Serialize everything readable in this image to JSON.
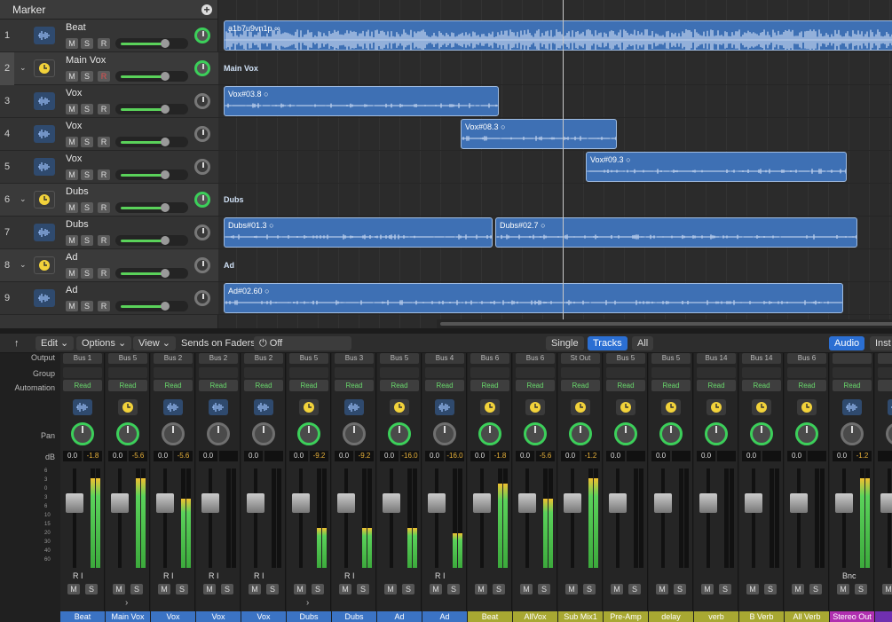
{
  "marker_label": "Marker",
  "tracks": [
    {
      "num": "1",
      "name": "Beat",
      "type": "audio",
      "r_red": false,
      "vol": 0.7,
      "pan_active": true
    },
    {
      "num": "2",
      "name": "Main Vox",
      "type": "folder",
      "r_red": true,
      "vol": 0.7,
      "pan_active": true
    },
    {
      "num": "3",
      "name": "Vox",
      "type": "audio",
      "r_red": false,
      "vol": 0.7,
      "pan_active": false
    },
    {
      "num": "4",
      "name": "Vox",
      "type": "audio",
      "r_red": false,
      "vol": 0.7,
      "pan_active": false
    },
    {
      "num": "5",
      "name": "Vox",
      "type": "audio",
      "r_red": false,
      "vol": 0.7,
      "pan_active": false
    },
    {
      "num": "6",
      "name": "Dubs",
      "type": "folder",
      "r_red": false,
      "vol": 0.7,
      "pan_active": true
    },
    {
      "num": "7",
      "name": "Dubs",
      "type": "audio",
      "r_red": false,
      "vol": 0.7,
      "pan_active": false
    },
    {
      "num": "8",
      "name": "Ad",
      "type": "folder",
      "r_red": false,
      "vol": 0.7,
      "pan_active": false
    },
    {
      "num": "9",
      "name": "Ad",
      "type": "audio",
      "r_red": false,
      "vol": 0.7,
      "pan_active": false
    }
  ],
  "regions": [
    {
      "label": "a1b7u9vn1p",
      "loop": "∞",
      "row": 0
    },
    {
      "label": "Main Vox",
      "row": 1,
      "stack": true
    },
    {
      "label": "Vox#03.8",
      "loop": "○",
      "row": 2
    },
    {
      "label": "Vox#08.3",
      "loop": "○",
      "row": 3
    },
    {
      "label": "Vox#09.3",
      "loop": "○",
      "row": 4
    },
    {
      "label": "Dubs",
      "row": 5,
      "stack": true
    },
    {
      "label": "Dubs#01.3",
      "loop": "○",
      "row": 6
    },
    {
      "label": "Dubs#02.7",
      "loop": "○",
      "row": 6
    },
    {
      "label": "Ad",
      "row": 7,
      "stack": true
    },
    {
      "label": "Ad#02.60",
      "loop": "○",
      "row": 8
    }
  ],
  "mixbar": {
    "edit": "Edit",
    "options": "Options",
    "view": "View",
    "sends_label": "Sends on Faders:",
    "sends_value": "Off",
    "single": "Single",
    "tracks": "Tracks",
    "all": "All",
    "audio": "Audio",
    "inst": "Inst"
  },
  "row_labels": {
    "output": "Output",
    "group": "Group",
    "automation": "Automation",
    "pan": "Pan",
    "db": "dB"
  },
  "strips": [
    {
      "output": "Bus 1",
      "auto": "Read",
      "icon": "wave",
      "db0": "0.0",
      "db1": "-1.8",
      "name": "Beat",
      "color": "#3b73c4",
      "pan_active": true,
      "ri": "R I"
    },
    {
      "output": "Bus 5",
      "auto": "Read",
      "icon": "folder",
      "db0": "0.0",
      "db1": "-5.6",
      "name": "Main Vox",
      "color": "#3b73c4",
      "pan_active": true,
      "ri": ""
    },
    {
      "output": "Bus 2",
      "auto": "Read",
      "icon": "wave",
      "db0": "0.0",
      "db1": "-5.6",
      "name": "Vox",
      "color": "#3b73c4",
      "pan_active": false,
      "ri": "R I"
    },
    {
      "output": "Bus 2",
      "auto": "Read",
      "icon": "wave",
      "db0": "0.0",
      "db1": "",
      "name": "Vox",
      "color": "#3b73c4",
      "pan_active": false,
      "ri": "R I"
    },
    {
      "output": "Bus 2",
      "auto": "Read",
      "icon": "wave",
      "db0": "0.0",
      "db1": "",
      "name": "Vox",
      "color": "#3b73c4",
      "pan_active": false,
      "ri": "R I"
    },
    {
      "output": "Bus 5",
      "auto": "Read",
      "icon": "folder",
      "db0": "0.0",
      "db1": "-9.2",
      "name": "Dubs",
      "color": "#3b73c4",
      "pan_active": true,
      "ri": ""
    },
    {
      "output": "Bus 3",
      "auto": "Read",
      "icon": "wave",
      "db0": "0.0",
      "db1": "-9.2",
      "name": "Dubs",
      "color": "#3b73c4",
      "pan_active": false,
      "ri": "R I"
    },
    {
      "output": "Bus 5",
      "auto": "Read",
      "icon": "folder",
      "db0": "0.0",
      "db1": "-16.0",
      "name": "Ad",
      "color": "#3b73c4",
      "pan_active": true,
      "ri": ""
    },
    {
      "output": "Bus 4",
      "auto": "Read",
      "icon": "wave",
      "db0": "0.0",
      "db1": "-16.0",
      "name": "Ad",
      "color": "#3b73c4",
      "pan_active": false,
      "ri": "R I"
    },
    {
      "output": "Bus 6",
      "auto": "Read",
      "icon": "folder",
      "db0": "0.0",
      "db1": "-1.8",
      "name": "Beat",
      "color": "#a8a832",
      "pan_active": true,
      "ri": ""
    },
    {
      "output": "Bus 6",
      "auto": "Read",
      "icon": "folder",
      "db0": "0.0",
      "db1": "-5.6",
      "name": "AllVox",
      "color": "#a8a832",
      "pan_active": true,
      "ri": ""
    },
    {
      "output": "St Out",
      "auto": "Read",
      "icon": "folder",
      "db0": "0.0",
      "db1": "-1.2",
      "name": "Sub Mix1",
      "color": "#a8a832",
      "pan_active": true,
      "ri": ""
    },
    {
      "output": "Bus 5",
      "auto": "Read",
      "icon": "folder",
      "db0": "0.0",
      "db1": "",
      "name": "Pre-Amp",
      "color": "#a8a832",
      "pan_active": true,
      "ri": ""
    },
    {
      "output": "Bus 5",
      "auto": "Read",
      "icon": "folder",
      "db0": "0.0",
      "db1": "",
      "name": "delay",
      "color": "#a8a832",
      "pan_active": true,
      "ri": ""
    },
    {
      "output": "Bus 14",
      "auto": "Read",
      "icon": "folder",
      "db0": "0.0",
      "db1": "",
      "name": "verb",
      "color": "#a8a832",
      "pan_active": true,
      "ri": ""
    },
    {
      "output": "Bus 14",
      "auto": "Read",
      "icon": "folder",
      "db0": "0.0",
      "db1": "",
      "name": "B Verb",
      "color": "#a8a832",
      "pan_active": true,
      "ri": ""
    },
    {
      "output": "Bus 6",
      "auto": "Read",
      "icon": "folder",
      "db0": "0.0",
      "db1": "",
      "name": "All Verb",
      "color": "#a8a832",
      "pan_active": true,
      "ri": ""
    },
    {
      "output": "",
      "auto": "Read",
      "icon": "wave",
      "db0": "0.0",
      "db1": "-1.2",
      "name": "Stereo Out",
      "color": "#b02fb0",
      "pan_active": false,
      "ri": "Bnc"
    },
    {
      "output": "",
      "auto": "Re",
      "icon": "wave",
      "db0": "",
      "db1": "",
      "name": "Ma",
      "color": "#7030b0",
      "pan_active": false,
      "ri": ""
    }
  ]
}
